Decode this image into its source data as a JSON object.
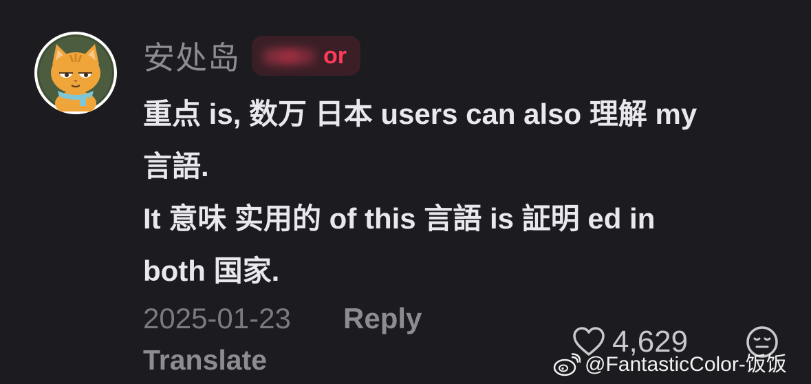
{
  "comment": {
    "username": "安处岛",
    "badge_visible_text": "or",
    "lines": [
      "重点 is, 数万 日本 users can also 理解 my",
      "言語.",
      "It 意味 实用的 of this 言語 is 証明 ed in",
      "both 国家."
    ],
    "date": "2025-01-23",
    "reply_label": "Reply",
    "translate_label": "Translate",
    "like_count": "4,629"
  },
  "icons": {
    "avatar": "cartoon-cat-avatar",
    "like": "heart-outline-icon",
    "reaction": "expressionless-face-icon",
    "watermark": "weibo-logo-icon"
  },
  "watermark": {
    "text": "@FantasticColor-饭饭"
  },
  "colors": {
    "background": "#1c1b20",
    "primary_text": "#e9e8ec",
    "secondary_text": "#8d8c92",
    "badge_accent": "#ff3b5a"
  }
}
